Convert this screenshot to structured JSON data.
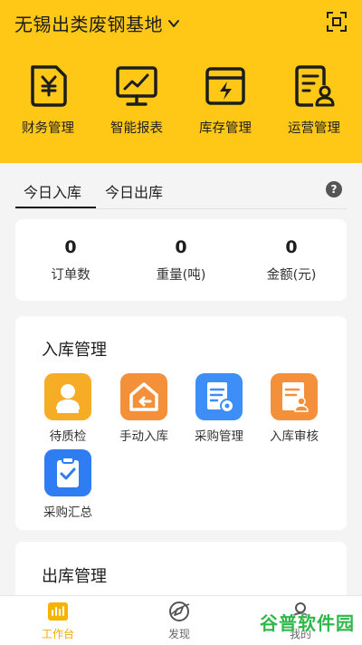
{
  "header": {
    "site_title": "无锡出类废钢基地",
    "accent": "#ffc817"
  },
  "quick_actions": [
    {
      "label": "财务管理",
      "icon": "yen-document-icon"
    },
    {
      "label": "智能报表",
      "icon": "monitor-chart-icon"
    },
    {
      "label": "库存管理",
      "icon": "battery-bolt-icon"
    },
    {
      "label": "运营管理",
      "icon": "user-document-icon"
    }
  ],
  "tabs": {
    "active": "今日入库",
    "inactive": "今日出库",
    "help": "?"
  },
  "stats": [
    {
      "value": "0",
      "label": "订单数"
    },
    {
      "value": "0",
      "label": "重量(吨)"
    },
    {
      "value": "0",
      "label": "金额(元)"
    }
  ],
  "inbound": {
    "title": "入库管理",
    "items": [
      {
        "label": "待质检",
        "icon": "inspector-icon",
        "color": "#f5a623"
      },
      {
        "label": "手动入库",
        "icon": "home-arrow-icon",
        "color": "#f58a3a"
      },
      {
        "label": "采购管理",
        "icon": "purchase-doc-icon",
        "color": "#3d8ef7"
      },
      {
        "label": "入库审核",
        "icon": "audit-doc-icon",
        "color": "#f58a3a"
      },
      {
        "label": "采购汇总",
        "icon": "clipboard-check-icon",
        "color": "#2f7df2"
      }
    ]
  },
  "outbound": {
    "title": "出库管理"
  },
  "bottom_nav": [
    {
      "label": "工作台",
      "icon": "workbench-icon",
      "active": true
    },
    {
      "label": "发现",
      "icon": "compass-icon",
      "active": false
    },
    {
      "label": "我的",
      "icon": "user-icon",
      "active": false
    }
  ],
  "watermark": "谷普软件园"
}
